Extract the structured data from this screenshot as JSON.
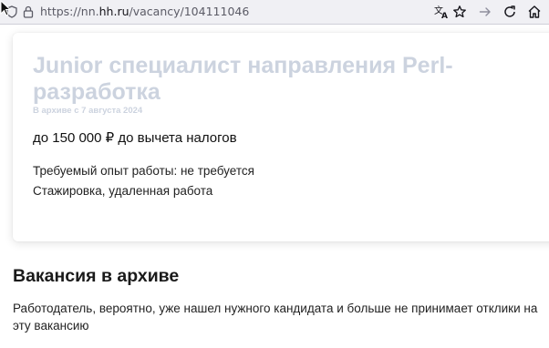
{
  "browser": {
    "url_prefix": "https://nn.",
    "url_host": "hh.ru",
    "url_path": "/vacancy/104111046"
  },
  "vacancy": {
    "title": "Junior специалист направления Perl-разработка",
    "archived_note": "В архиве с 7 августа 2024",
    "salary": "до 150 000 ₽ до вычета налогов",
    "experience": "Требуемый опыт работы: не требуется",
    "employment": "Стажировка, удаленная работа"
  },
  "archive_notice": {
    "title": "Вакансия в архиве",
    "text": "Работодатель, вероятно, уже нашел нужного кандидата и больше не принимает отклики на эту вакансию"
  },
  "icons": {
    "cursor": "mouse-pointer",
    "shield": "tracking-protection-shield",
    "lock": "padlock",
    "translate": "translate",
    "star": "bookmark-star",
    "forward": "forward-arrow",
    "reload": "reload",
    "home": "home"
  }
}
